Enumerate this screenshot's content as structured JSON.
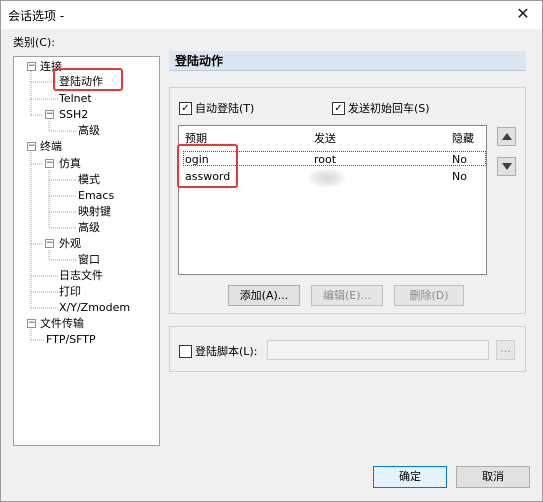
{
  "window": {
    "title": "会话选项 -",
    "close_glyph": "✕"
  },
  "category_label": "类别(C):",
  "tree": {
    "items": [
      {
        "label": "连接",
        "expander": "−"
      },
      {
        "label": "登陆动作"
      },
      {
        "label": "Telnet"
      },
      {
        "label": "SSH2",
        "expander": "−"
      },
      {
        "label": "高级"
      },
      {
        "label": "终端",
        "expander": "−"
      },
      {
        "label": "仿真",
        "expander": "−"
      },
      {
        "label": "模式"
      },
      {
        "label": "Emacs"
      },
      {
        "label": "映射键"
      },
      {
        "label": "高级"
      },
      {
        "label": "外观",
        "expander": "−"
      },
      {
        "label": "窗口"
      },
      {
        "label": "日志文件"
      },
      {
        "label": "打印"
      },
      {
        "label": "X/Y/Zmodem"
      },
      {
        "label": "文件传输",
        "expander": "−"
      },
      {
        "label": "FTP/SFTP"
      }
    ]
  },
  "section_title": "登陆动作",
  "options": {
    "auto_login": {
      "label": "自动登陆(T)",
      "checked": true,
      "mark": "✓"
    },
    "send_cr": {
      "label": "发送初始回车(S)",
      "checked": true,
      "mark": "✓"
    }
  },
  "table": {
    "columns": [
      "预期",
      "发送",
      "隐藏"
    ],
    "rows": [
      {
        "expect": "ogin",
        "send": "root",
        "hidden": "No"
      },
      {
        "expect": "assword",
        "send": "",
        "hidden": "No"
      }
    ]
  },
  "buttons": {
    "add": "添加(A)...",
    "edit": "编辑(E)...",
    "delete": "删除(D)",
    "ok": "确定",
    "cancel": "取消",
    "browse": "..."
  },
  "login_script": {
    "label": "登陆脚本(L):",
    "checked": false,
    "value": ""
  },
  "colors": {
    "accent": "#0078d7",
    "highlight": "#e53935",
    "header_bg": "#dce6f0"
  }
}
